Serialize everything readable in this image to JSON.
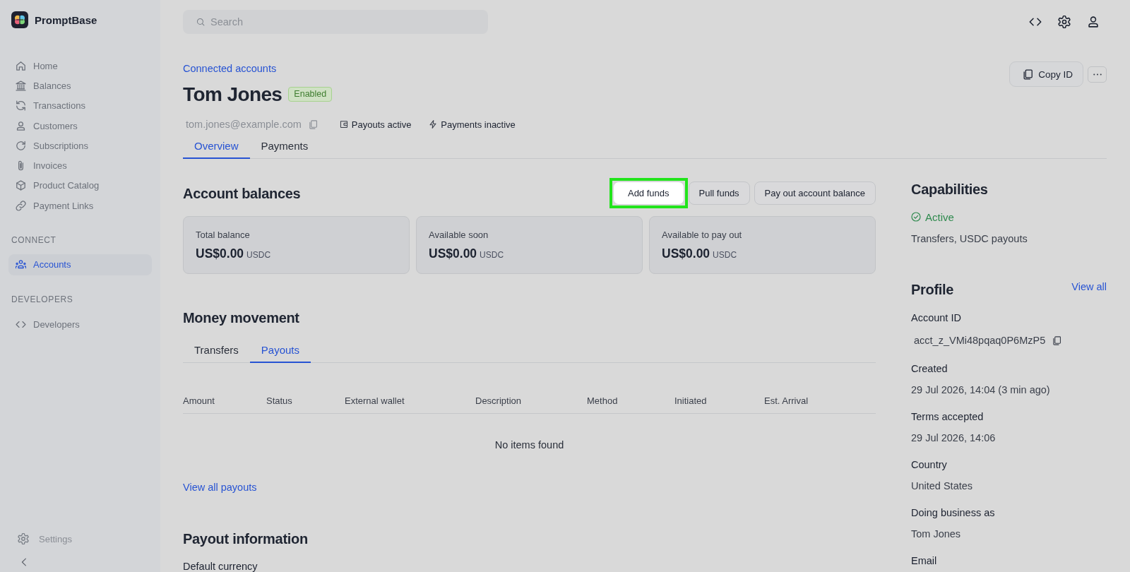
{
  "sidebar": {
    "brand": "PromptBase",
    "nav": [
      {
        "label": "Home",
        "selected": false
      },
      {
        "label": "Balances",
        "selected": false
      },
      {
        "label": "Transactions",
        "selected": false
      },
      {
        "label": "Customers",
        "selected": false
      },
      {
        "label": "Subscriptions",
        "selected": false
      },
      {
        "label": "Invoices",
        "selected": false
      },
      {
        "label": "Product Catalog",
        "selected": false
      },
      {
        "label": "Payment Links",
        "selected": false
      }
    ],
    "sections": [
      {
        "title": "CONNECT",
        "items": [
          {
            "label": "Accounts",
            "selected": true
          }
        ]
      },
      {
        "title": "DEVELOPERS",
        "items": [
          {
            "label": "Developers",
            "selected": false
          }
        ]
      }
    ],
    "footer": {
      "label": "Settings"
    }
  },
  "topbar": {
    "search": {
      "placeholder": "Search"
    }
  },
  "header": {
    "breadcrumb": "Connected accounts",
    "title": "Tom Jones",
    "badge": "Enabled",
    "email": "tom.jones@example.com",
    "statuses": [
      "Payouts active",
      "Payments inactive"
    ],
    "copy_button": "Copy ID",
    "tabs": [
      {
        "label": "Overview",
        "selected": true
      },
      {
        "label": "Payments",
        "selected": false
      }
    ]
  },
  "balances": {
    "title": "Account balances",
    "actions": [
      {
        "label": "Add funds",
        "highlighted": true
      },
      {
        "label": "Pull funds",
        "highlighted": false
      },
      {
        "label": "Pay out account balance",
        "highlighted": false
      }
    ],
    "cards": [
      {
        "label": "Total balance",
        "amount": "US$0.00",
        "currency": "USDC"
      },
      {
        "label": "Available soon",
        "amount": "US$0.00",
        "currency": "USDC"
      },
      {
        "label": "Available to pay out",
        "amount": "US$0.00",
        "currency": "USDC"
      }
    ]
  },
  "money_movement": {
    "title": "Money movement",
    "tabs": [
      {
        "label": "Transfers",
        "selected": false
      },
      {
        "label": "Payouts",
        "selected": true
      }
    ],
    "table": {
      "columns": [
        "Amount",
        "Status",
        "External wallet",
        "Description",
        "Method",
        "Initiated",
        "Est. Arrival"
      ],
      "empty": "No items found"
    },
    "link": "View all payouts"
  },
  "payout_information": {
    "title": "Payout information",
    "fields": [
      {
        "label": "Default currency"
      }
    ]
  },
  "capabilities": {
    "title": "Capabilities",
    "status": "Active",
    "description": "Transfers, USDC payouts"
  },
  "profile": {
    "title": "Profile",
    "link": "View all",
    "fields": [
      {
        "label": "Account ID",
        "value": "acct_z_VMi48pqaq0P6MzP5",
        "copyable": true
      },
      {
        "label": "Created",
        "value": "29 Jul 2026, 14:04 (3 min ago)",
        "copyable": false
      },
      {
        "label": "Terms accepted",
        "value": "29 Jul 2026, 14:06",
        "copyable": false
      },
      {
        "label": "Country",
        "value": "United States",
        "copyable": false
      },
      {
        "label": "Doing business as",
        "value": "Tom Jones",
        "copyable": false
      },
      {
        "label": "Email"
      }
    ]
  }
}
